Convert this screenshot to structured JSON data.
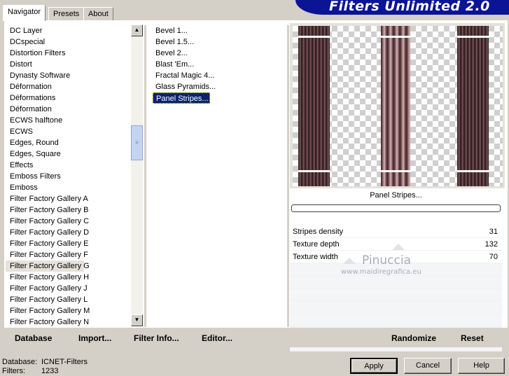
{
  "tabs": [
    {
      "label": "Navigator",
      "active": true
    },
    {
      "label": "Presets",
      "active": false
    },
    {
      "label": "About",
      "active": false
    }
  ],
  "banner": {
    "title": "Filters Unlimited 2.0"
  },
  "categories": {
    "items": [
      "DC Layer",
      "DCspecial",
      "Distortion Filters",
      "Distort",
      "Dynasty Software",
      "Déformation",
      "Déformations",
      "Déformation",
      "ECWS halftone",
      "ECWS",
      "Edges, Round",
      "Edges, Square",
      "Effects",
      "Emboss Filters",
      "Emboss",
      "Filter Factory Gallery A",
      "Filter Factory Gallery B",
      "Filter Factory Gallery C",
      "Filter Factory Gallery D",
      "Filter Factory Gallery E",
      "Filter Factory Gallery F",
      "Filter Factory Gallery G",
      "Filter Factory Gallery H",
      "Filter Factory Gallery J",
      "Filter Factory Gallery L",
      "Filter Factory Gallery M",
      "Filter Factory Gallery N"
    ],
    "selected": "Filter Factory Gallery G"
  },
  "filters": {
    "items": [
      "Bevel 1...",
      "Bevel 1.5...",
      "Bevel 2...",
      "Blast 'Em...",
      "Fractal Magic 4...",
      "Glass Pyramids...",
      "Panel Stripes..."
    ],
    "selected": "Panel Stripes..."
  },
  "preview": {
    "effect_name": "Panel Stripes..."
  },
  "params": [
    {
      "name": "Stripes density",
      "value": "31"
    },
    {
      "name": "Texture depth",
      "value": "132"
    },
    {
      "name": "Texture width",
      "value": "70"
    }
  ],
  "watermark": {
    "line1": "Pinuccia",
    "line2": "www.maidiregrafica.eu"
  },
  "toolbar": {
    "database": "Database",
    "import": "Import...",
    "filter_info": "Filter Info...",
    "editor": "Editor...",
    "randomize": "Randomize",
    "reset": "Reset"
  },
  "status": {
    "database_label": "Database:",
    "database_value": "ICNET-Filters",
    "filters_label": "Filters:",
    "filters_value": "1233"
  },
  "buttons": {
    "apply": "Apply",
    "cancel": "Cancel",
    "help": "Help"
  },
  "icons": {
    "scroll_up": "chevron-up-icon",
    "scroll_down": "chevron-down-icon"
  },
  "colors": {
    "banner": "#0b1494",
    "selection": "#0a246a",
    "dialog": "#d4d0c8"
  }
}
